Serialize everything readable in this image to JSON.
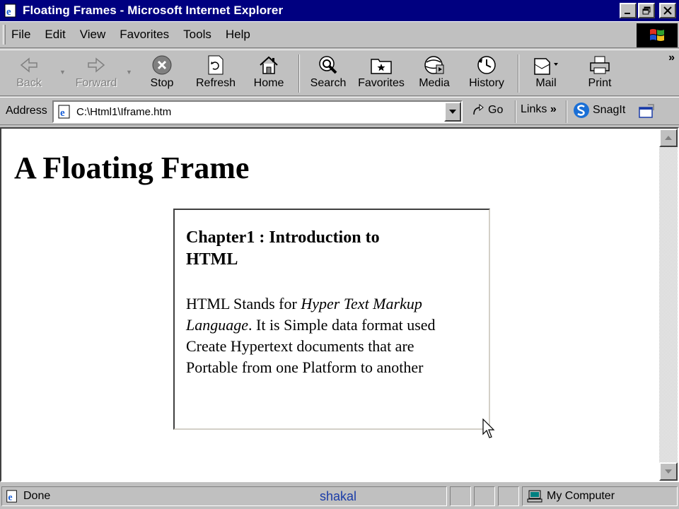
{
  "window": {
    "title": "Floating Frames - Microsoft Internet Explorer"
  },
  "menu": [
    "File",
    "Edit",
    "View",
    "Favorites",
    "Tools",
    "Help"
  ],
  "toolbar": {
    "back": "Back",
    "forward": "Forward",
    "stop": "Stop",
    "refresh": "Refresh",
    "home": "Home",
    "search": "Search",
    "favorites": "Favorites",
    "media": "Media",
    "history": "History",
    "mail": "Mail",
    "print": "Print"
  },
  "address": {
    "label": "Address",
    "url": "C:\\Html1\\Iframe.htm",
    "go": "Go",
    "links": "Links",
    "snagit": "SnagIt"
  },
  "page": {
    "heading": "A Floating Frame",
    "iframe": {
      "heading": "Chapter1 : Introduction to HTML",
      "text_before": "HTML Stands for ",
      "text_italic": "Hyper Text Markup Language",
      "text_after": ". It is Simple data format used Create Hypertext documents that are Portable from one Platform to another"
    }
  },
  "status": {
    "text": "Done",
    "watermark": "shakal",
    "zone": "My Computer"
  },
  "colors": {
    "titlebar": "#000080",
    "chrome": "#c0c0c0"
  }
}
